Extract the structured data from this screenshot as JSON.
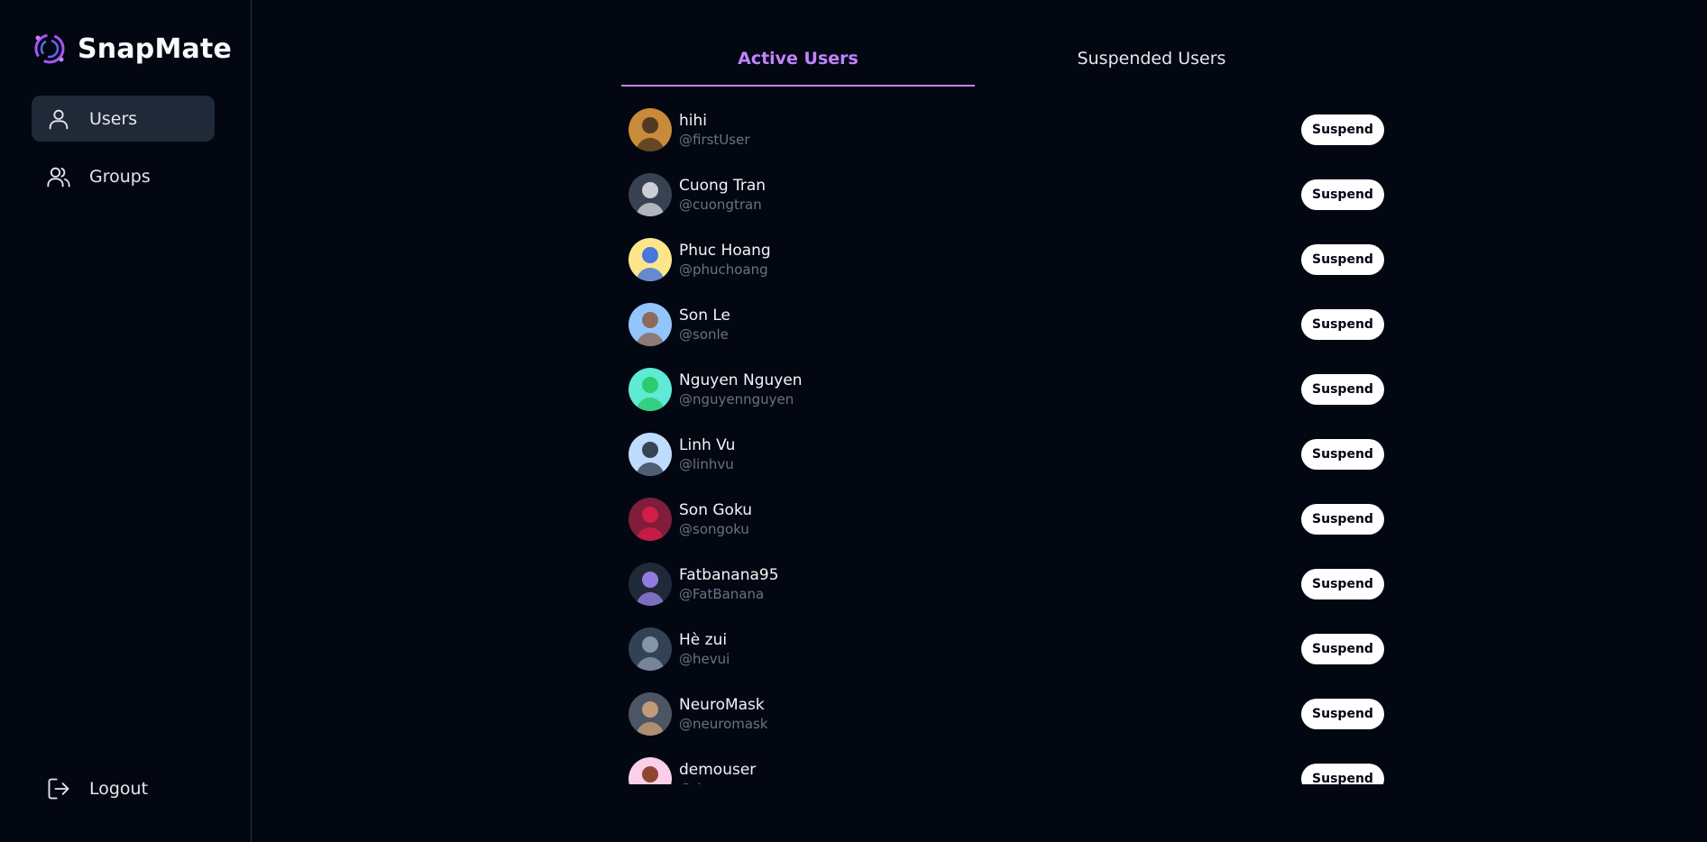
{
  "brand": {
    "name": "SnapMate",
    "accent": "#a855f7"
  },
  "sidebar": {
    "items": [
      {
        "label": "Users",
        "icon": "user-icon",
        "active": true
      },
      {
        "label": "Groups",
        "icon": "users-icon",
        "active": false
      }
    ],
    "logout_label": "Logout"
  },
  "tabs": [
    {
      "label": "Active Users",
      "active": true
    },
    {
      "label": "Suspended Users",
      "active": false
    }
  ],
  "users": [
    {
      "name": "hihi",
      "handle": "@firstUser",
      "avatar_bg": "#c98a3a",
      "avatar_fg": "#3b2a1c"
    },
    {
      "name": "Cuong Tran",
      "handle": "@cuongtran",
      "avatar_bg": "#374151",
      "avatar_fg": "#e5e7eb"
    },
    {
      "name": "Phuc Hoang",
      "handle": "@phuchoang",
      "avatar_bg": "#fde68a",
      "avatar_fg": "#2563eb"
    },
    {
      "name": "Son Le",
      "handle": "@sonle",
      "avatar_bg": "#93c5fd",
      "avatar_fg": "#8b5a3c"
    },
    {
      "name": "Nguyen Nguyen",
      "handle": "@nguyennguyen",
      "avatar_bg": "#5eead4",
      "avatar_fg": "#22c55e"
    },
    {
      "name": "Linh Vu",
      "handle": "@linhvu",
      "avatar_bg": "#bfdbfe",
      "avatar_fg": "#1f2937"
    },
    {
      "name": "Son Goku",
      "handle": "@songoku",
      "avatar_bg": "#7f1d3a",
      "avatar_fg": "#e11d48"
    },
    {
      "name": "Fatbanana95",
      "handle": "@FatBanana",
      "avatar_bg": "#1f2937",
      "avatar_fg": "#a78bfa"
    },
    {
      "name": "Hè zui",
      "handle": "@hevui",
      "avatar_bg": "#334155",
      "avatar_fg": "#94a3b8"
    },
    {
      "name": "NeuroMask",
      "handle": "@neuromask",
      "avatar_bg": "#4b5563",
      "avatar_fg": "#d6a77a"
    },
    {
      "name": "demouser",
      "handle": "@demouser",
      "avatar_bg": "#fbcfe8",
      "avatar_fg": "#7c2d12"
    }
  ],
  "suspend_label": "Suspend"
}
